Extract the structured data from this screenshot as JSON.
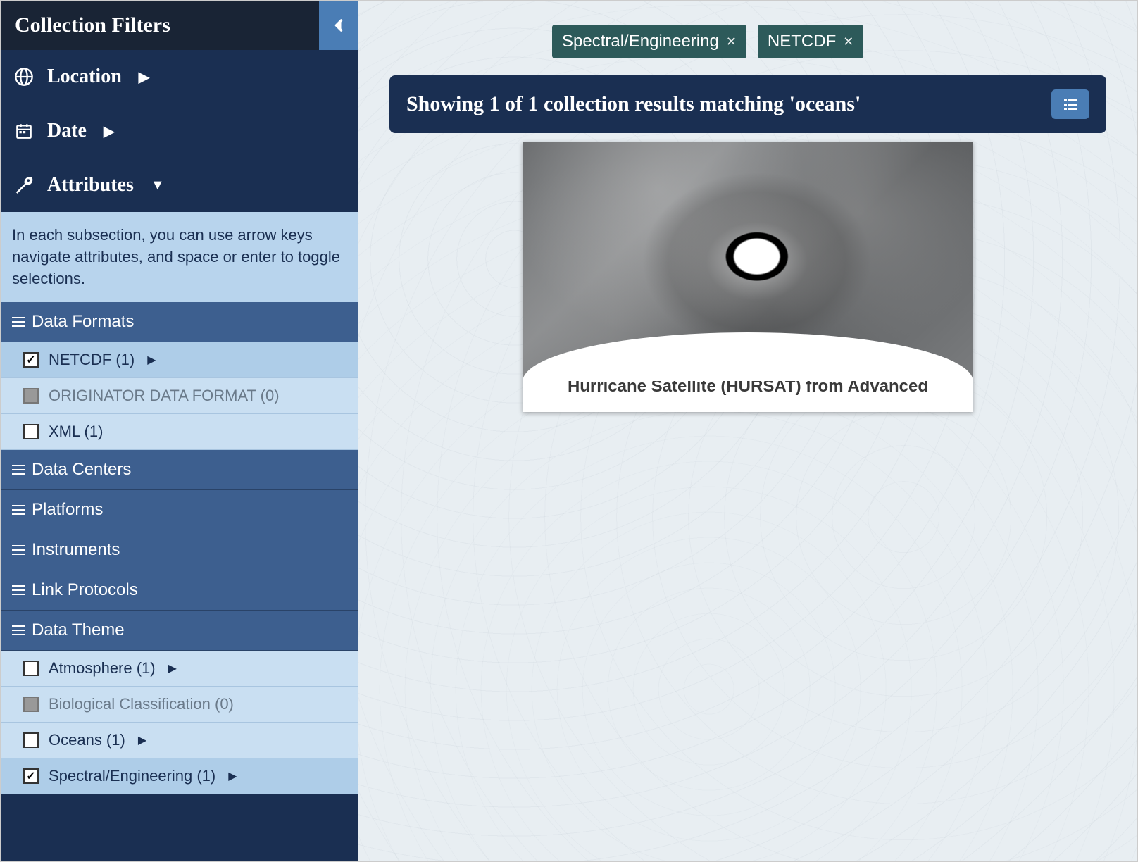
{
  "sidebar": {
    "title": "Collection Filters",
    "nav": {
      "location": "Location",
      "date": "Date",
      "attributes": "Attributes"
    },
    "help_text": "In each subsection, you can use arrow keys navigate attributes, and space or enter to toggle selections.",
    "sections": {
      "data_formats": {
        "label": "Data Formats",
        "items": [
          {
            "label": "NETCDF (1)",
            "checked": true,
            "disabled": false,
            "expandable": true
          },
          {
            "label": "ORIGINATOR DATA FORMAT (0)",
            "checked": false,
            "disabled": true,
            "expandable": false
          },
          {
            "label": "XML (1)",
            "checked": false,
            "disabled": false,
            "expandable": false
          }
        ]
      },
      "data_centers": {
        "label": "Data Centers"
      },
      "platforms": {
        "label": "Platforms"
      },
      "instruments": {
        "label": "Instruments"
      },
      "link_protocols": {
        "label": "Link Protocols"
      },
      "data_theme": {
        "label": "Data Theme",
        "items": [
          {
            "label": "Atmosphere (1)",
            "checked": false,
            "disabled": false,
            "expandable": true
          },
          {
            "label": "Biological Classification (0)",
            "checked": false,
            "disabled": true,
            "expandable": false
          },
          {
            "label": "Oceans (1)",
            "checked": false,
            "disabled": false,
            "expandable": true
          },
          {
            "label": "Spectral/Engineering (1)",
            "checked": true,
            "disabled": false,
            "expandable": true
          }
        ]
      }
    }
  },
  "main": {
    "chips": [
      {
        "label": "Spectral/Engineering"
      },
      {
        "label": "NETCDF"
      }
    ],
    "results_text": "Showing 1 of 1 collection results matching 'oceans'",
    "card": {
      "title": "Hurricane Satellite (HURSAT) from Advanced"
    }
  }
}
